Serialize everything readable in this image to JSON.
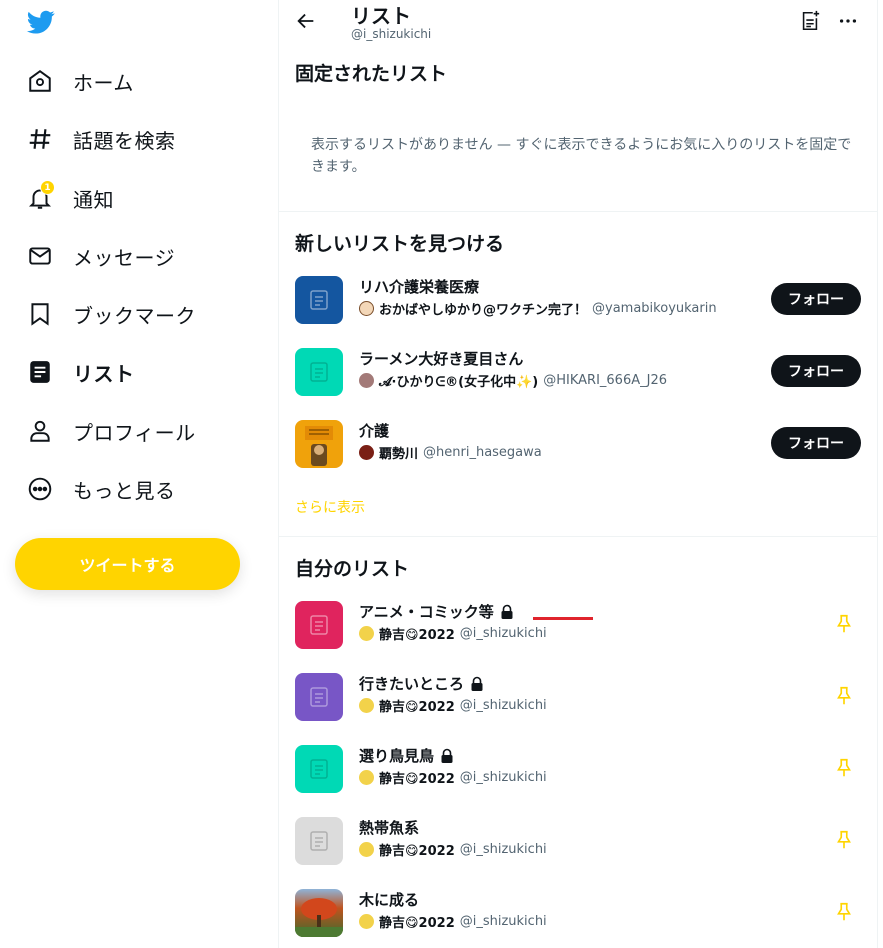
{
  "sidebar": {
    "items": [
      {
        "label": "ホーム",
        "icon": "home-icon"
      },
      {
        "label": "話題を検索",
        "icon": "hashtag-icon"
      },
      {
        "label": "通知",
        "icon": "bell-icon",
        "badge": "1"
      },
      {
        "label": "メッセージ",
        "icon": "mail-icon"
      },
      {
        "label": "ブックマーク",
        "icon": "bookmark-icon"
      },
      {
        "label": "リスト",
        "icon": "list-icon",
        "active": true
      },
      {
        "label": "プロフィール",
        "icon": "profile-icon"
      },
      {
        "label": "もっと見る",
        "icon": "more-circle-icon"
      }
    ],
    "tweet_button": "ツイートする"
  },
  "header": {
    "title": "リスト",
    "handle": "@i_shizukichi"
  },
  "pinned": {
    "title": "固定されたリスト",
    "empty_text": "表示するリストがありません — すぐに表示できるようにお気に入りのリストを固定できます。"
  },
  "discover": {
    "title": "新しいリストを見つける",
    "follow_label": "フォロー",
    "show_more": "さらに表示",
    "lists": [
      {
        "name": "リハ介護栄養医療",
        "owner": "おかばやしゆかり@ワクチン完了！",
        "handle": "@yamabikoyukarin",
        "thumb_color": "#1456a0"
      },
      {
        "name": "ラーメン大好き夏目さん",
        "owner": "𝓐·ひかりᕮ®(女子化中✨)",
        "handle": "@HIKARI_666A_J26",
        "thumb_color": "#00d9b5"
      },
      {
        "name": "介護",
        "owner": "覇勢川",
        "handle": "@henri_hasegawa",
        "thumb_color": "#f0a20b"
      }
    ]
  },
  "my_lists": {
    "title": "自分のリスト",
    "lists": [
      {
        "name": "アニメ・コミック等",
        "locked": true,
        "owner": "静吉😋2022",
        "handle": "@i_shizukichi",
        "thumb_color": "#e0245e"
      },
      {
        "name": "行きたいところ",
        "locked": true,
        "owner": "静吉😋2022",
        "handle": "@i_shizukichi",
        "thumb_color": "#7856c6"
      },
      {
        "name": "選り鳥見鳥",
        "locked": true,
        "owner": "静吉😋2022",
        "handle": "@i_shizukichi",
        "thumb_color": "#00d9b5"
      },
      {
        "name": "熱帯魚系",
        "locked": false,
        "owner": "静吉😋2022",
        "handle": "@i_shizukichi",
        "thumb_color": "#dcdcdc"
      },
      {
        "name": "木に成る",
        "locked": false,
        "owner": "静吉😋2022",
        "handle": "@i_shizukichi",
        "thumb_color": "#c0531e"
      }
    ]
  },
  "colors": {
    "accent": "#ffd400",
    "text": "#0f1419",
    "muted": "#536471",
    "twitter_blue": "#1d9bf0"
  }
}
